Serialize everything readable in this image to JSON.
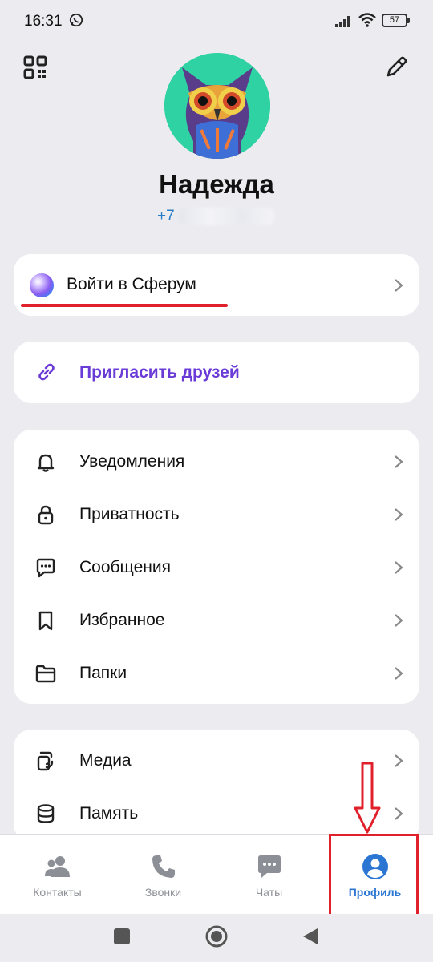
{
  "status_bar": {
    "time": "16:31",
    "battery": "57"
  },
  "profile": {
    "name": "Надежда",
    "phone_prefix": "+7"
  },
  "sferum": {
    "label": "Войти в Сферум"
  },
  "invite": {
    "label": "Пригласить друзей"
  },
  "settings": {
    "items": [
      {
        "label": "Уведомления",
        "icon": "bell-icon"
      },
      {
        "label": "Приватность",
        "icon": "lock-icon"
      },
      {
        "label": "Сообщения",
        "icon": "message-icon"
      },
      {
        "label": "Избранное",
        "icon": "bookmark-icon"
      },
      {
        "label": "Папки",
        "icon": "folder-icon"
      }
    ]
  },
  "storage": {
    "items": [
      {
        "label": "Медиа",
        "icon": "media-icon"
      },
      {
        "label": "Память",
        "icon": "database-icon"
      }
    ]
  },
  "bottom_nav": {
    "items": [
      {
        "label": "Контакты",
        "icon": "contacts-icon"
      },
      {
        "label": "Звонки",
        "icon": "phone-icon"
      },
      {
        "label": "Чаты",
        "icon": "chat-icon"
      },
      {
        "label": "Профиль",
        "icon": "profile-icon",
        "active": true
      }
    ]
  },
  "colors": {
    "accent": "#2a76d2",
    "invite": "#6a3bd6",
    "highlight": "#e0202a",
    "background": "#ececf0"
  }
}
